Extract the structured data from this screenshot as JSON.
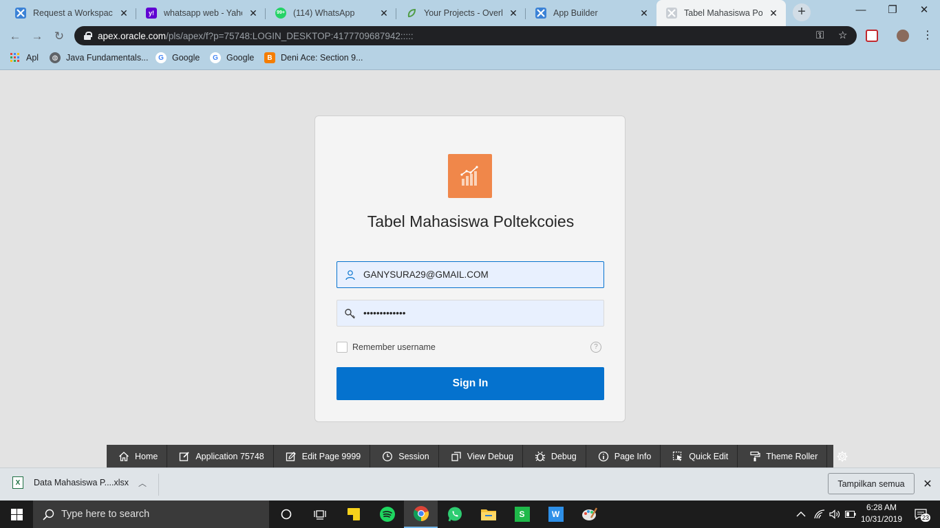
{
  "browser": {
    "tabs": [
      {
        "title": "Request a Workspace - ...",
        "icon": "apex-icon"
      },
      {
        "title": "whatsapp web - Yahoo Search",
        "icon": "yahoo-icon"
      },
      {
        "title": "(114) WhatsApp",
        "icon": "whatsapp-icon"
      },
      {
        "title": "Your Projects - Overleaf",
        "icon": "overleaf-icon"
      },
      {
        "title": "App Builder",
        "icon": "apex-icon"
      },
      {
        "title": "Tabel Mahasiswa Poltekcoies",
        "icon": "apex-icon"
      }
    ],
    "url_host": "apex.oracle.com",
    "url_path": "/pls/apex/f?p=75748:LOGIN_DESKTOP:4177709687942:::::",
    "bookmarks": [
      {
        "label": "Apl",
        "icon": "apps-grid-icon"
      },
      {
        "label": "Java Fundamentals...",
        "icon": "globe-icon"
      },
      {
        "label": "Google",
        "icon": "google-icon"
      },
      {
        "label": "Google",
        "icon": "google-icon"
      },
      {
        "label": "Deni Ace: Section 9...",
        "icon": "blogger-icon"
      }
    ]
  },
  "login": {
    "app_title": "Tabel Mahasiswa Poltekcoies",
    "username_value": "GANYSURA29@GMAIL.COM",
    "password_value": "•••••••••••••",
    "remember_label": "Remember username",
    "help_glyph": "?",
    "signin_label": "Sign In"
  },
  "devbar": [
    {
      "label": "Home",
      "icon": "home-icon"
    },
    {
      "label": "Application 75748",
      "icon": "edit-box-icon"
    },
    {
      "label": "Edit Page 9999",
      "icon": "pencil-icon"
    },
    {
      "label": "Session",
      "icon": "clock-icon"
    },
    {
      "label": "View Debug",
      "icon": "view-debug-icon"
    },
    {
      "label": "Debug",
      "icon": "bug-icon"
    },
    {
      "label": "Page Info",
      "icon": "info-icon"
    },
    {
      "label": "Quick Edit",
      "icon": "quick-edit-icon"
    },
    {
      "label": "Theme Roller",
      "icon": "paint-roller-icon"
    }
  ],
  "download": {
    "filename": "Data Mahasiswa P....xlsx",
    "show_all": "Tampilkan semua"
  },
  "taskbar": {
    "search_placeholder": "Type here to search",
    "time": "6:28 AM",
    "date": "10/31/2019",
    "notification_count": "23"
  },
  "colors": {
    "accent": "#0572ce",
    "logo": "#f0874a",
    "chrome_frame": "#b6d2e4"
  }
}
